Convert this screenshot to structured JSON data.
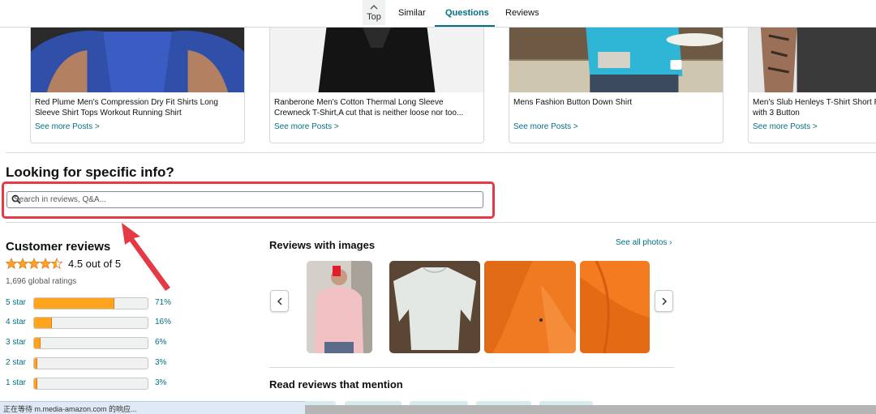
{
  "topnav": {
    "top_label": "Top",
    "tabs": [
      {
        "label": "Similar"
      },
      {
        "label": "Questions"
      },
      {
        "label": "Reviews"
      }
    ]
  },
  "posts": [
    {
      "title": "Red Plume Men's Compression Dry Fit Shirts Long Sleeve Shirt Tops Workout Running Shirt",
      "more": "See more Posts >"
    },
    {
      "title": "Ranberone Men's Cotton Thermal Long Sleeve Crewneck T-Shirt,A cut that is neither loose nor too...",
      "more": "See more Posts >"
    },
    {
      "title": "Mens Fashion Button Down Shirt",
      "more": "See more Posts >"
    },
    {
      "title": "Men's Slub Henleys T-Shirt Short Relaxed Fit Casual with 3 Button",
      "more": "See more Posts >"
    }
  ],
  "search": {
    "heading": "Looking for specific info?",
    "placeholder": "Search in reviews, Q&A..."
  },
  "customer_reviews": {
    "title": "Customer reviews",
    "rating": 4.5,
    "rating_text": "4.5 out of 5",
    "global_ratings": "1,696 global ratings",
    "histogram": [
      {
        "label": "5 star",
        "pct": "71%",
        "value": 71
      },
      {
        "label": "4 star",
        "pct": "16%",
        "value": 16
      },
      {
        "label": "3 star",
        "pct": "6%",
        "value": 6
      },
      {
        "label": "2 star",
        "pct": "3%",
        "value": 3
      },
      {
        "label": "1 star",
        "pct": "3%",
        "value": 3
      }
    ]
  },
  "reviews_with_images": {
    "title": "Reviews with images",
    "see_all": "See all photos ›",
    "prev_icon": "chevron-left-icon",
    "next_icon": "chevron-right-icon"
  },
  "read_reviews": {
    "title": "Read reviews that mention"
  },
  "status_bar": {
    "text": "正在等待 m.media-amazon.com 的响应..."
  },
  "colors": {
    "accent": "#007185",
    "star": "#ffa41c",
    "highlight": "#e63946"
  }
}
